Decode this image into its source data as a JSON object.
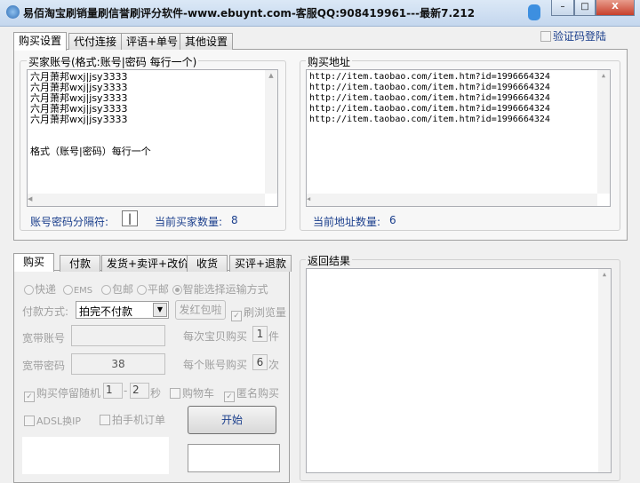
{
  "window": {
    "title": "易佰淘宝刷销量刷信誉刷评分软件-www.ebuynt.com-客服QQ:908419961---最新7.212",
    "minimize": "–",
    "maximize": "□",
    "close": "X"
  },
  "captcha_login": "验证码登陆",
  "top_tabs": [
    "购买设置",
    "代付连接",
    "评语+单号",
    "其他设置"
  ],
  "buyer": {
    "label": "买家账号(格式:账号|密码 每行一个)",
    "text": "六月萧邦wxj|jsy3333\n六月萧邦wxj|jsy3333\n六月萧邦wxj|jsy3333\n六月萧邦wxj|jsy3333\n六月萧邦wxj|jsy3333\n\n\n格式（账号|密码）每行一个",
    "separator_label": "账号密码分隔符:",
    "separator_value": "|",
    "count_label": "当前买家数量:",
    "count": "8"
  },
  "address": {
    "label": "购买地址",
    "text": "http://item.taobao.com/item.htm?id=1996664324\nhttp://item.taobao.com/item.htm?id=1996664324\nhttp://item.taobao.com/item.htm?id=1996664324\nhttp://item.taobao.com/item.htm?id=1996664324\nhttp://item.taobao.com/item.htm?id=1996664324",
    "count_label": "当前地址数量:",
    "count": "6"
  },
  "bottom_tabs": [
    "购买",
    "付款",
    "发货+卖评+改价",
    "收货",
    "买评+退款"
  ],
  "shipping": [
    "快递",
    "EMS",
    "包邮",
    "平邮",
    "智能选择运输方式"
  ],
  "payment_label": "付款方式:",
  "payment_value": "拍完不付款",
  "red_packet": "发红包啦",
  "browse": "刷浏览量",
  "broadband_account": "宽带账号",
  "broadband_password": "宽带密码",
  "broadband_password_value": "38",
  "per_item_label": "每次宝贝购买",
  "per_item_value": "1",
  "per_item_unit": "件",
  "per_account_label": "每个账号购买",
  "per_account_value": "6",
  "per_account_unit": "次",
  "stay_random": "购买停留随机",
  "stay_min": "1",
  "stay_dash": "-",
  "stay_max": "2",
  "stay_unit": "秒",
  "cart": "购物车",
  "anonymous": "匿名购买",
  "adsl": "ADSL换IP",
  "mobile_order": "拍手机订单",
  "start": "开始",
  "result_label": "返回结果"
}
